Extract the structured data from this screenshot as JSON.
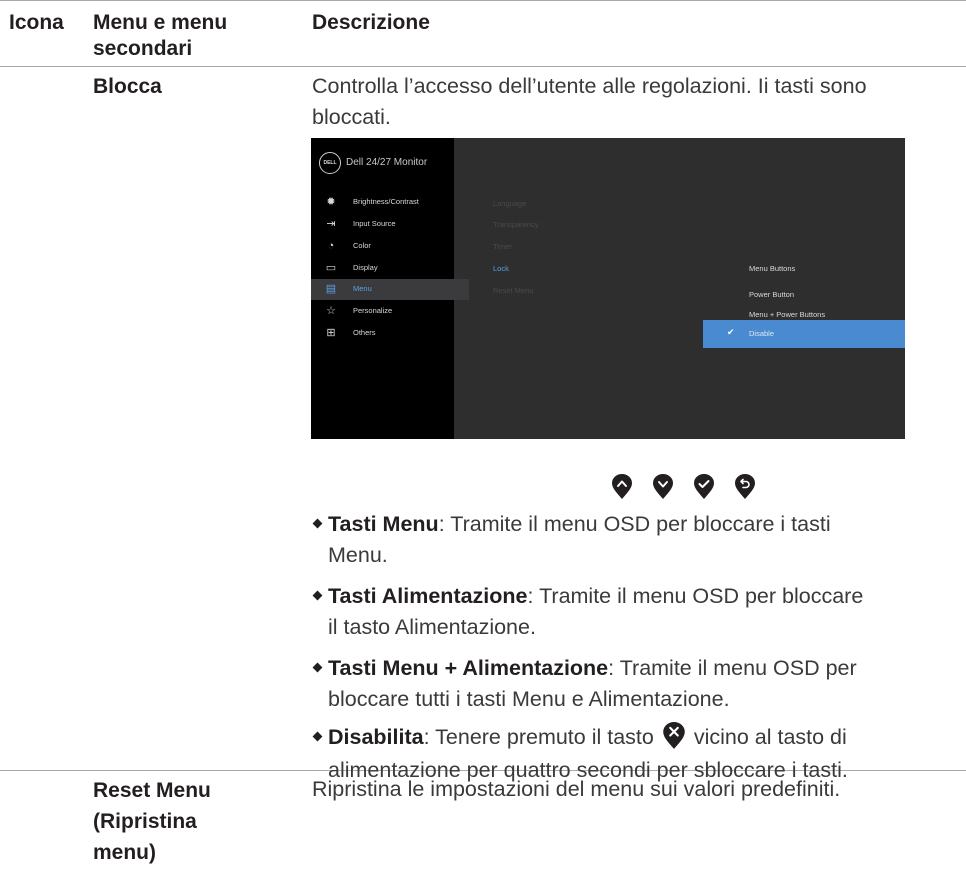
{
  "table": {
    "header": {
      "col_icon": "Icona",
      "col_menu_1": "Menu e menu",
      "col_menu_2": "secondari",
      "col_desc": "Descrizione"
    },
    "rows": [
      {
        "name": "Blocca",
        "description": "Controlla l’accesso dell’utente alle regolazioni. Ii tasti sono bloccati.",
        "desc_line1": "Controlla l’accesso dell’utente alle regolazioni. Ii tasti sono",
        "desc_line2": "bloccati.",
        "bullets": [
          {
            "title": "Tasti Menu",
            "line1": ": Tramite il menu OSD per bloccare i tasti",
            "line2": "Menu."
          },
          {
            "title": "Tasti Alimentazione",
            "line1": ": Tramite il menu OSD per bloccare",
            "line2": "il tasto Alimentazione."
          },
          {
            "title": "Tasti Menu + Alimentazione",
            "line1": ": Tramite il menu OSD per",
            "line2": "bloccare tutti i tasti Menu e Alimentazione."
          },
          {
            "title": "Disabilita",
            "line1_a": ": Tenere premuto il tasto",
            "line1_b": "vicino al tasto di",
            "line2": "alimentazione per quattro secondi per sbloccare i tasti."
          }
        ]
      },
      {
        "name_1": "Reset Menu",
        "name_2": "(Ripristina",
        "name_3": "menu)",
        "description": "Ripristina le impostazioni del menu sui valori predefiniti."
      }
    ]
  },
  "osd": {
    "logo": "DELL",
    "title": "Dell 24/27 Monitor",
    "sidebar": [
      {
        "label": "Brightness/Contrast",
        "icon": "sun-icon"
      },
      {
        "label": "Input Source",
        "icon": "input-icon"
      },
      {
        "label": "Color",
        "icon": "palette-icon"
      },
      {
        "label": "Display",
        "icon": "monitor-icon"
      },
      {
        "label": "Menu",
        "icon": "menu-icon",
        "active": true
      },
      {
        "label": "Personalize",
        "icon": "star-icon"
      },
      {
        "label": "Others",
        "icon": "others-icon"
      }
    ],
    "submenu": [
      "Language",
      "Transparency",
      "Timer",
      "Lock",
      "Reset Menu"
    ],
    "selected_submenu": "Lock",
    "options": [
      "Menu Buttons",
      "Power Button",
      "Menu + Power Buttons",
      "Disable"
    ],
    "selected_option": "Disable"
  },
  "buttons": [
    {
      "icon": "up-arrow-icon"
    },
    {
      "icon": "down-arrow-icon"
    },
    {
      "icon": "check-icon"
    },
    {
      "icon": "back-icon"
    }
  ],
  "colors": {
    "text": "#231f20",
    "rule": "#a7a9ac",
    "osd_accent": "#4a8ad0"
  }
}
